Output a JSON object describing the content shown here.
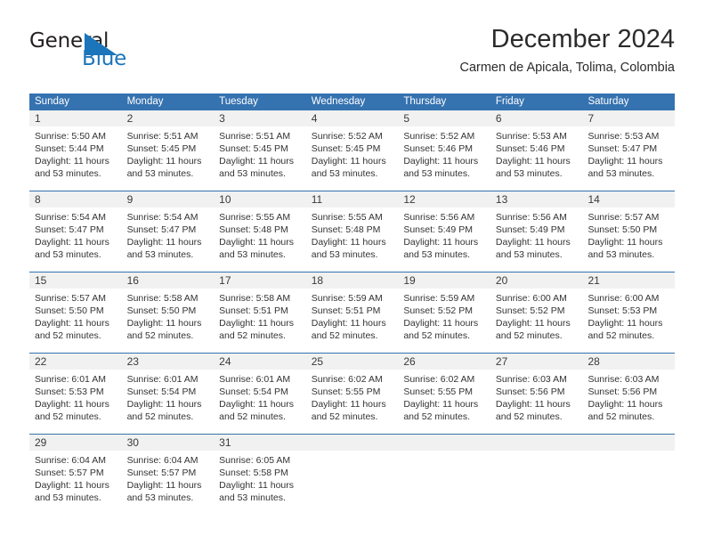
{
  "brand": {
    "name_top": "General",
    "name_bottom": "Blue",
    "color_dark": "#231f20",
    "color_blue": "#1b75bb"
  },
  "header": {
    "title": "December 2024",
    "subtitle": "Carmen de Apicala, Tolima, Colombia"
  },
  "theme": {
    "header_blue": "#3572b0",
    "daynum_band": "#f1f1f1",
    "text": "#333333"
  },
  "calendar": {
    "weekdays": [
      "Sunday",
      "Monday",
      "Tuesday",
      "Wednesday",
      "Thursday",
      "Friday",
      "Saturday"
    ],
    "weeks": [
      [
        {
          "day": "1",
          "sunrise": "Sunrise: 5:50 AM",
          "sunset": "Sunset: 5:44 PM",
          "daylight1": "Daylight: 11 hours",
          "daylight2": "and 53 minutes."
        },
        {
          "day": "2",
          "sunrise": "Sunrise: 5:51 AM",
          "sunset": "Sunset: 5:45 PM",
          "daylight1": "Daylight: 11 hours",
          "daylight2": "and 53 minutes."
        },
        {
          "day": "3",
          "sunrise": "Sunrise: 5:51 AM",
          "sunset": "Sunset: 5:45 PM",
          "daylight1": "Daylight: 11 hours",
          "daylight2": "and 53 minutes."
        },
        {
          "day": "4",
          "sunrise": "Sunrise: 5:52 AM",
          "sunset": "Sunset: 5:45 PM",
          "daylight1": "Daylight: 11 hours",
          "daylight2": "and 53 minutes."
        },
        {
          "day": "5",
          "sunrise": "Sunrise: 5:52 AM",
          "sunset": "Sunset: 5:46 PM",
          "daylight1": "Daylight: 11 hours",
          "daylight2": "and 53 minutes."
        },
        {
          "day": "6",
          "sunrise": "Sunrise: 5:53 AM",
          "sunset": "Sunset: 5:46 PM",
          "daylight1": "Daylight: 11 hours",
          "daylight2": "and 53 minutes."
        },
        {
          "day": "7",
          "sunrise": "Sunrise: 5:53 AM",
          "sunset": "Sunset: 5:47 PM",
          "daylight1": "Daylight: 11 hours",
          "daylight2": "and 53 minutes."
        }
      ],
      [
        {
          "day": "8",
          "sunrise": "Sunrise: 5:54 AM",
          "sunset": "Sunset: 5:47 PM",
          "daylight1": "Daylight: 11 hours",
          "daylight2": "and 53 minutes."
        },
        {
          "day": "9",
          "sunrise": "Sunrise: 5:54 AM",
          "sunset": "Sunset: 5:47 PM",
          "daylight1": "Daylight: 11 hours",
          "daylight2": "and 53 minutes."
        },
        {
          "day": "10",
          "sunrise": "Sunrise: 5:55 AM",
          "sunset": "Sunset: 5:48 PM",
          "daylight1": "Daylight: 11 hours",
          "daylight2": "and 53 minutes."
        },
        {
          "day": "11",
          "sunrise": "Sunrise: 5:55 AM",
          "sunset": "Sunset: 5:48 PM",
          "daylight1": "Daylight: 11 hours",
          "daylight2": "and 53 minutes."
        },
        {
          "day": "12",
          "sunrise": "Sunrise: 5:56 AM",
          "sunset": "Sunset: 5:49 PM",
          "daylight1": "Daylight: 11 hours",
          "daylight2": "and 53 minutes."
        },
        {
          "day": "13",
          "sunrise": "Sunrise: 5:56 AM",
          "sunset": "Sunset: 5:49 PM",
          "daylight1": "Daylight: 11 hours",
          "daylight2": "and 53 minutes."
        },
        {
          "day": "14",
          "sunrise": "Sunrise: 5:57 AM",
          "sunset": "Sunset: 5:50 PM",
          "daylight1": "Daylight: 11 hours",
          "daylight2": "and 53 minutes."
        }
      ],
      [
        {
          "day": "15",
          "sunrise": "Sunrise: 5:57 AM",
          "sunset": "Sunset: 5:50 PM",
          "daylight1": "Daylight: 11 hours",
          "daylight2": "and 52 minutes."
        },
        {
          "day": "16",
          "sunrise": "Sunrise: 5:58 AM",
          "sunset": "Sunset: 5:50 PM",
          "daylight1": "Daylight: 11 hours",
          "daylight2": "and 52 minutes."
        },
        {
          "day": "17",
          "sunrise": "Sunrise: 5:58 AM",
          "sunset": "Sunset: 5:51 PM",
          "daylight1": "Daylight: 11 hours",
          "daylight2": "and 52 minutes."
        },
        {
          "day": "18",
          "sunrise": "Sunrise: 5:59 AM",
          "sunset": "Sunset: 5:51 PM",
          "daylight1": "Daylight: 11 hours",
          "daylight2": "and 52 minutes."
        },
        {
          "day": "19",
          "sunrise": "Sunrise: 5:59 AM",
          "sunset": "Sunset: 5:52 PM",
          "daylight1": "Daylight: 11 hours",
          "daylight2": "and 52 minutes."
        },
        {
          "day": "20",
          "sunrise": "Sunrise: 6:00 AM",
          "sunset": "Sunset: 5:52 PM",
          "daylight1": "Daylight: 11 hours",
          "daylight2": "and 52 minutes."
        },
        {
          "day": "21",
          "sunrise": "Sunrise: 6:00 AM",
          "sunset": "Sunset: 5:53 PM",
          "daylight1": "Daylight: 11 hours",
          "daylight2": "and 52 minutes."
        }
      ],
      [
        {
          "day": "22",
          "sunrise": "Sunrise: 6:01 AM",
          "sunset": "Sunset: 5:53 PM",
          "daylight1": "Daylight: 11 hours",
          "daylight2": "and 52 minutes."
        },
        {
          "day": "23",
          "sunrise": "Sunrise: 6:01 AM",
          "sunset": "Sunset: 5:54 PM",
          "daylight1": "Daylight: 11 hours",
          "daylight2": "and 52 minutes."
        },
        {
          "day": "24",
          "sunrise": "Sunrise: 6:01 AM",
          "sunset": "Sunset: 5:54 PM",
          "daylight1": "Daylight: 11 hours",
          "daylight2": "and 52 minutes."
        },
        {
          "day": "25",
          "sunrise": "Sunrise: 6:02 AM",
          "sunset": "Sunset: 5:55 PM",
          "daylight1": "Daylight: 11 hours",
          "daylight2": "and 52 minutes."
        },
        {
          "day": "26",
          "sunrise": "Sunrise: 6:02 AM",
          "sunset": "Sunset: 5:55 PM",
          "daylight1": "Daylight: 11 hours",
          "daylight2": "and 52 minutes."
        },
        {
          "day": "27",
          "sunrise": "Sunrise: 6:03 AM",
          "sunset": "Sunset: 5:56 PM",
          "daylight1": "Daylight: 11 hours",
          "daylight2": "and 52 minutes."
        },
        {
          "day": "28",
          "sunrise": "Sunrise: 6:03 AM",
          "sunset": "Sunset: 5:56 PM",
          "daylight1": "Daylight: 11 hours",
          "daylight2": "and 52 minutes."
        }
      ],
      [
        {
          "day": "29",
          "sunrise": "Sunrise: 6:04 AM",
          "sunset": "Sunset: 5:57 PM",
          "daylight1": "Daylight: 11 hours",
          "daylight2": "and 53 minutes."
        },
        {
          "day": "30",
          "sunrise": "Sunrise: 6:04 AM",
          "sunset": "Sunset: 5:57 PM",
          "daylight1": "Daylight: 11 hours",
          "daylight2": "and 53 minutes."
        },
        {
          "day": "31",
          "sunrise": "Sunrise: 6:05 AM",
          "sunset": "Sunset: 5:58 PM",
          "daylight1": "Daylight: 11 hours",
          "daylight2": "and 53 minutes."
        },
        null,
        null,
        null,
        null
      ]
    ]
  }
}
